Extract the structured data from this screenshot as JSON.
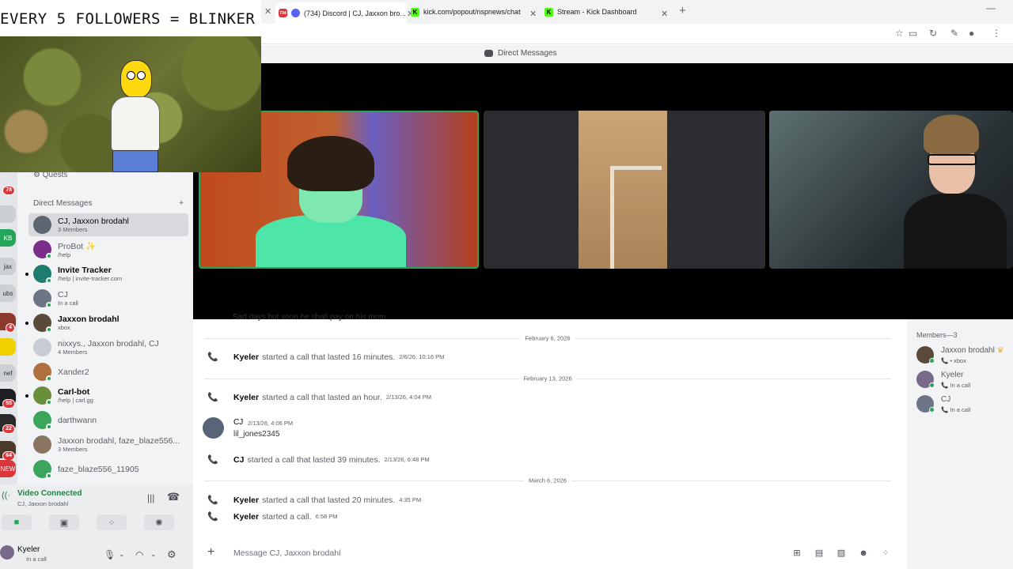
{
  "overlay": {
    "banner": "EVERY 5 FOLLOWERS = BLINKER"
  },
  "browser": {
    "tabs": [
      {
        "label": "(734) Discord | CJ, Jaxxon bro...",
        "favicon": "discord-icon",
        "badge": "734"
      },
      {
        "label": "kick.com/popout/nspnews/chat",
        "favicon": "kick-icon"
      },
      {
        "label": "Stream - Kick Dashboard",
        "favicon": "kick-icon"
      }
    ],
    "new_tab": "+",
    "window_min": "—"
  },
  "discord": {
    "title": "Direct Messages",
    "sidebar": {
      "quests": "Quests",
      "dm_header": "Direct Messages",
      "add": "+",
      "dms": [
        {
          "name": "CJ, Jaxxon brodahl",
          "sub": "3 Members",
          "color": "#5c6670",
          "active": true,
          "bold": false
        },
        {
          "name": "ProBot ✨",
          "sub": "/help",
          "color": "#7b2d8b",
          "bold": false
        },
        {
          "name": "Invite Tracker",
          "sub": "/help | invite-tracker.com",
          "color": "#1e7b6e",
          "bold": true
        },
        {
          "name": "CJ",
          "sub": "In a call",
          "color": "#6b7585",
          "bold": false
        },
        {
          "name": "Jaxxon brodahl",
          "sub": "xbox",
          "color": "#5a4a3a",
          "bold": true
        },
        {
          "name": "nixxys., Jaxxon brodahl, CJ",
          "sub": "4 Members",
          "color": "#c8ccd4",
          "bold": false
        },
        {
          "name": "Xander2",
          "sub": "",
          "color": "#b07040",
          "bold": false
        },
        {
          "name": "Carl-bot",
          "sub": "/help | carl.gg",
          "color": "#6b8e3a",
          "bold": true
        },
        {
          "name": "darthwann",
          "sub": "",
          "color": "#3ba55c",
          "bold": false
        },
        {
          "name": "Jaxxon brodahl, faze_blaze556...",
          "sub": "3 Members",
          "color": "#8a7560",
          "bold": false
        },
        {
          "name": "faze_blaze556_11905",
          "sub": "",
          "color": "#3ba55c",
          "bold": false
        }
      ]
    },
    "server_rail": [
      {
        "label": "",
        "badge": "78"
      },
      {
        "label": "",
        "badge": ""
      },
      {
        "label": "KB",
        "badge": ""
      },
      {
        "label": "jax",
        "badge": ""
      },
      {
        "label": "ubs",
        "badge": ""
      },
      {
        "label": "",
        "badge": "4"
      },
      {
        "label": "",
        "badge": ""
      },
      {
        "label": "nef",
        "badge": ""
      },
      {
        "label": "",
        "badge": "55"
      },
      {
        "label": "",
        "badge": "22"
      },
      {
        "label": "",
        "badge": "64"
      },
      {
        "label": "NEW",
        "badge": ""
      }
    ],
    "voice": {
      "title": "Video Connected",
      "sub": "CJ, Jaxxon brodahl"
    },
    "user": {
      "name": "Kyeler",
      "status": "In a call"
    },
    "chat": {
      "cut_message": "Sad days but soon he shall pay on his mom",
      "dividers": [
        "February 6, 2026",
        "February 13, 2026",
        "March 6, 2026"
      ],
      "calls": [
        {
          "author": "Kyeler",
          "text": "started a call that lasted 16 minutes.",
          "ts": "2/6/26, 10:16 PM"
        },
        {
          "author": "Kyeler",
          "text": "started a call that lasted an hour.",
          "ts": "2/13/26, 4:04 PM"
        },
        {
          "author": "CJ",
          "text": "started a call that lasted 39 minutes.",
          "ts": "2/13/26, 6:48 PM"
        },
        {
          "author": "Kyeler",
          "text": "started a call that lasted 20 minutes.",
          "ts": "4:35 PM"
        },
        {
          "author": "Kyeler",
          "text": "started a call.",
          "ts": "6:58 PM"
        }
      ],
      "message": {
        "author": "CJ",
        "ts": "2/13/26, 4:06 PM",
        "text": "lil_jones2345"
      },
      "composer_placeholder": "Message CJ, Jaxxon brodahl"
    },
    "members": {
      "title": "Members—3",
      "list": [
        {
          "name": "Jaxxon brodahl",
          "sub": "xbox",
          "color": "#5a4a3a",
          "crown": "♛"
        },
        {
          "name": "Kyeler",
          "sub": "In a call",
          "color": "#7a6a8a"
        },
        {
          "name": "CJ",
          "sub": "In a call",
          "color": "#6b7585"
        }
      ]
    }
  },
  "colors": {
    "accent_green": "#23a55a",
    "discord_blurple": "#5865f2",
    "kick_green": "#53fc18"
  }
}
